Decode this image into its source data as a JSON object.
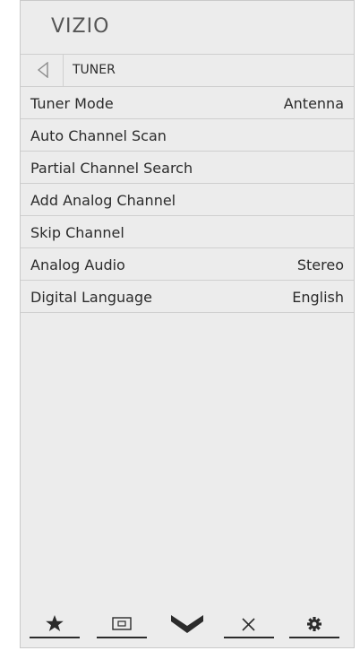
{
  "brand": "VIZIO",
  "header": {
    "back_label": "TUNER"
  },
  "menu": {
    "items": [
      {
        "label": "Tuner Mode",
        "value": "Antenna"
      },
      {
        "label": "Auto Channel Scan",
        "value": ""
      },
      {
        "label": "Partial Channel Search",
        "value": ""
      },
      {
        "label": "Add Analog Channel",
        "value": ""
      },
      {
        "label": "Skip Channel",
        "value": ""
      },
      {
        "label": "Analog Audio",
        "value": "Stereo"
      },
      {
        "label": "Digital Language",
        "value": "English"
      }
    ]
  },
  "bottom_bar": {
    "icons": [
      "star-icon",
      "screen-icon",
      "chevron-down-icon",
      "close-icon",
      "gear-icon"
    ]
  },
  "colors": {
    "panel_bg": "#ececec",
    "text": "#2b2b2b",
    "divider": "#cfcfcf"
  }
}
